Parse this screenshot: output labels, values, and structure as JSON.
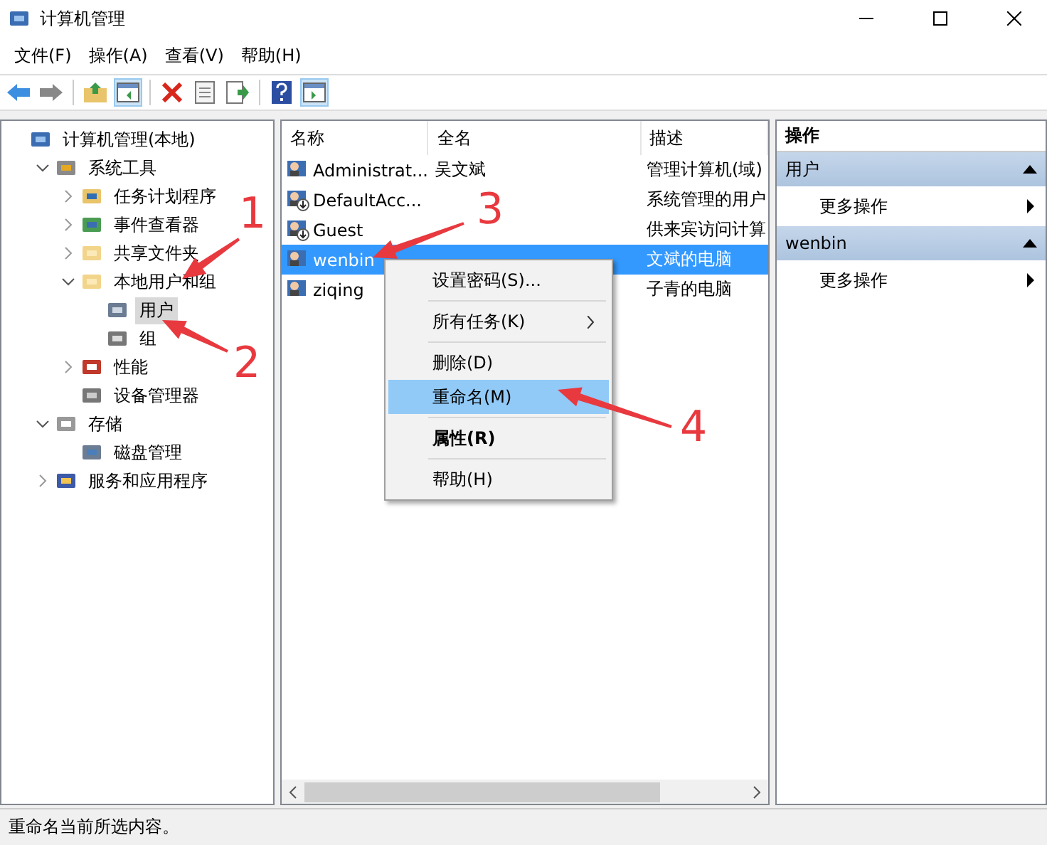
{
  "window": {
    "title": "计算机管理"
  },
  "menu": [
    "文件(F)",
    "操作(A)",
    "查看(V)",
    "帮助(H)"
  ],
  "tree": [
    {
      "label": "计算机管理(本地)",
      "selected": false,
      "children": [
        {
          "label": "系统工具",
          "expanded": true,
          "selected": false,
          "children": [
            {
              "label": "任务计划程序",
              "expanded": false,
              "selected": false
            },
            {
              "label": "事件查看器",
              "expanded": false,
              "selected": false
            },
            {
              "label": "共享文件夹",
              "expanded": false,
              "selected": false
            },
            {
              "label": "本地用户和组",
              "expanded": true,
              "selected": false,
              "children": [
                {
                  "label": "用户",
                  "selected": true
                },
                {
                  "label": "组",
                  "selected": false
                }
              ]
            },
            {
              "label": "性能",
              "expanded": false,
              "selected": false
            },
            {
              "label": "设备管理器",
              "selected": false
            }
          ]
        },
        {
          "label": "存储",
          "expanded": true,
          "selected": false,
          "children": [
            {
              "label": "磁盘管理",
              "selected": false
            }
          ]
        },
        {
          "label": "服务和应用程序",
          "expanded": false,
          "selected": false
        }
      ]
    }
  ],
  "table": {
    "columns": [
      "名称",
      "全名",
      "描述"
    ],
    "rows": [
      {
        "name": "Administrat...",
        "full_name": "吴文斌",
        "description": "管理计算机(域)",
        "selected": false,
        "disabled": false
      },
      {
        "name": "DefaultAcc...",
        "description": "系统管理的用户",
        "selected": false,
        "disabled": true
      },
      {
        "name": "Guest",
        "description": "供来宾访问计算",
        "selected": false,
        "disabled": true
      },
      {
        "name": "wenbin",
        "description": "文斌的电脑",
        "selected": true,
        "disabled": false
      },
      {
        "name": "ziqing",
        "description": "子青的电脑",
        "selected": false,
        "disabled": false
      }
    ]
  },
  "context_menu": [
    {
      "kind": "item",
      "label": "设置密码(S)...",
      "selected": false,
      "default": false
    },
    {
      "kind": "separator"
    },
    {
      "kind": "submenu",
      "label": "所有任务(K)",
      "selected": false,
      "default": false
    },
    {
      "kind": "separator"
    },
    {
      "kind": "item",
      "label": "删除(D)",
      "selected": false,
      "default": false
    },
    {
      "kind": "item",
      "label": "重命名(M)",
      "selected": true,
      "default": false
    },
    {
      "kind": "separator"
    },
    {
      "kind": "item",
      "label": "属性(R)",
      "selected": false,
      "default": true
    },
    {
      "kind": "separator"
    },
    {
      "kind": "item",
      "label": "帮助(H)",
      "selected": false,
      "default": false
    }
  ],
  "actions": {
    "title": "操作",
    "sections": [
      {
        "title": "用户",
        "items": [
          "更多操作"
        ]
      },
      {
        "title": "wenbin",
        "items": [
          "更多操作"
        ]
      }
    ]
  },
  "annotations": [
    {
      "label": "1"
    },
    {
      "label": "2"
    },
    {
      "label": "3"
    },
    {
      "label": "4"
    }
  ],
  "status_bar": "重命名当前所选内容。"
}
